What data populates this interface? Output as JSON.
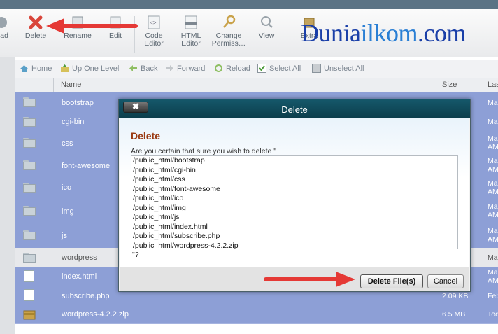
{
  "toolbar": {
    "items": [
      {
        "label": "load"
      },
      {
        "label": "Delete"
      },
      {
        "label": "Rename"
      },
      {
        "label": "Edit"
      },
      {
        "label": "Code\nEditor"
      },
      {
        "label": "HTML\nEditor"
      },
      {
        "label": "Change\nPermiss…"
      },
      {
        "label": "View"
      },
      {
        "label": "Extra"
      }
    ]
  },
  "watermark": {
    "part1": "Dunia",
    "part2": "ilkom",
    "part3": ".com"
  },
  "nav": {
    "home": "Home",
    "up_one_level": "Up One Level",
    "back": "Back",
    "forward": "Forward",
    "reload": "Reload",
    "select_all": "Select All",
    "unselect_all": "Unselect All"
  },
  "table": {
    "headers": {
      "name": "Name",
      "size": "Size",
      "last": "Las"
    },
    "rows": [
      {
        "name": "bootstrap",
        "size": "",
        "last": "Ma"
      },
      {
        "name": "cgi-bin",
        "size": "",
        "last": "Ma"
      },
      {
        "name": "css",
        "size": "",
        "last": "Ma\nAM"
      },
      {
        "name": "font-awesome",
        "size": "",
        "last": "Ma\nAM"
      },
      {
        "name": "ico",
        "size": "",
        "last": "Ma\nAM"
      },
      {
        "name": "img",
        "size": "",
        "last": "Ma\nAM"
      },
      {
        "name": "js",
        "size": "",
        "last": "Ma\nAM"
      },
      {
        "name": "wordpress",
        "size": "",
        "last": "Ma"
      },
      {
        "name": "index.html",
        "size": "",
        "last": "Ma\nAM"
      },
      {
        "name": "subscribe.php",
        "size": "2.09 KB",
        "last": "Feb"
      },
      {
        "name": "wordpress-4.2.2.zip",
        "size": "6.5 MB",
        "last": "Tod"
      }
    ]
  },
  "dialog": {
    "title": "Delete",
    "close_label": "✖",
    "heading": "Delete",
    "question": "Are you certain that sure you wish to delete \"",
    "files": [
      "/public_html/bootstrap",
      "/public_html/cgi-bin",
      "/public_html/css",
      "/public_html/font-awesome",
      "/public_html/ico",
      "/public_html/img",
      "/public_html/js",
      "/public_html/index.html",
      "/public_html/subscribe.php",
      "/public_html/wordpress-4.2.2.zip"
    ],
    "closing": "\"?",
    "delete_button": "Delete File(s)",
    "cancel_button": "Cancel"
  },
  "colors": {
    "row_selected": "#8d9fd6",
    "dialog_title": "#0c3e4c",
    "arrow": "#e53935",
    "heading": "#9a3a12"
  }
}
